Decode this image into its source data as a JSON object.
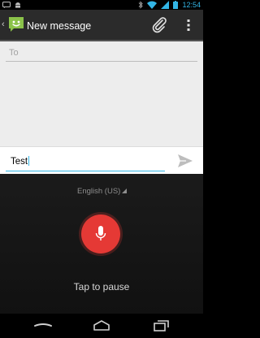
{
  "status_bar": {
    "time": "12:54",
    "left_icons": [
      "message-notification-icon",
      "android-notification-icon"
    ],
    "right_icons": [
      "bluetooth-icon",
      "wifi-icon",
      "signal-icon",
      "battery-icon"
    ]
  },
  "action_bar": {
    "title": "New message",
    "icons": [
      "messaging-app-icon",
      "attach-icon",
      "overflow-menu-icon"
    ]
  },
  "compose": {
    "to_placeholder": "To",
    "message_value": "Test",
    "send_icon": "send-icon"
  },
  "voice_input": {
    "language": "English (US)",
    "mic_icon": "microphone-icon",
    "status_text": "Tap to pause"
  },
  "nav_bar": {
    "buttons": [
      "back-icon",
      "home-icon",
      "recent-apps-icon"
    ]
  },
  "colors": {
    "accent": "#33b5e5",
    "mic_red": "#e53935",
    "action_bar_bg": "#2b2b2b",
    "compose_bg": "#ededed"
  }
}
